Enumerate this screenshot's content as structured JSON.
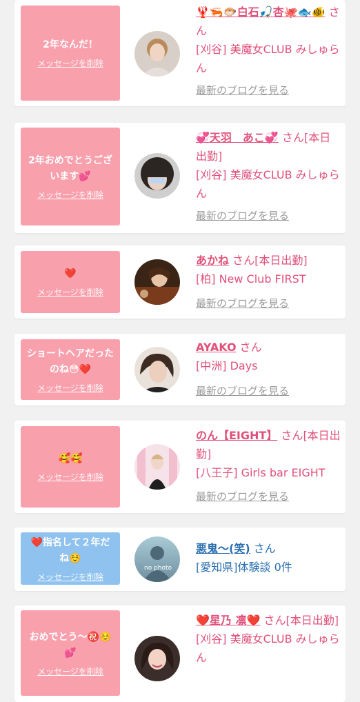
{
  "delete_label": "メッセージを削除",
  "blog_label": "最新のブログを見る",
  "san": "さん",
  "cards": [
    {
      "message": "2年なんだ！",
      "name": "🦞🦐🐡白石🎣杏🐙🐟🐠",
      "status": "",
      "shop": "[刈谷] 美魔女CLUB みしゅらん",
      "avatar": "woman-light-hair"
    },
    {
      "message": "2年おめでとうございます💕",
      "name": "💞天羽　あこ💞",
      "status": "[本日出勤]",
      "shop": "[刈谷] 美魔女CLUB みしゅらん",
      "avatar": "woman-bangs"
    },
    {
      "message": "❤️",
      "name": "あかね",
      "status": "[本日出勤]",
      "shop": "[柏] New Club FIRST",
      "avatar": "woman-dinner"
    },
    {
      "message": "ショートヘアだったのね😳❤️",
      "name": "AYAKO",
      "status": "",
      "shop": "[中洲] Days",
      "avatar": "woman-short-hair"
    },
    {
      "message": "🥰🥰",
      "name": "のん【EIGHT】",
      "status": "[本日出勤]",
      "shop": "[八王子] Girls bar EIGHT",
      "avatar": "woman-pink-room"
    },
    {
      "message": "❤️指名して２年だね☺️",
      "name": "悪鬼〜(笑)",
      "status": "",
      "shop": "[愛知県]体験談 0件",
      "avatar": "no-photo",
      "avatar_text": "no photo"
    },
    {
      "message": "おめでとう〜㊗️☺️💕",
      "name": "❤️星乃 凛❤️",
      "status": "[本日出勤]",
      "shop": "[刈谷] 美魔女CLUB みしゅらん",
      "avatar": "woman-smile"
    }
  ]
}
